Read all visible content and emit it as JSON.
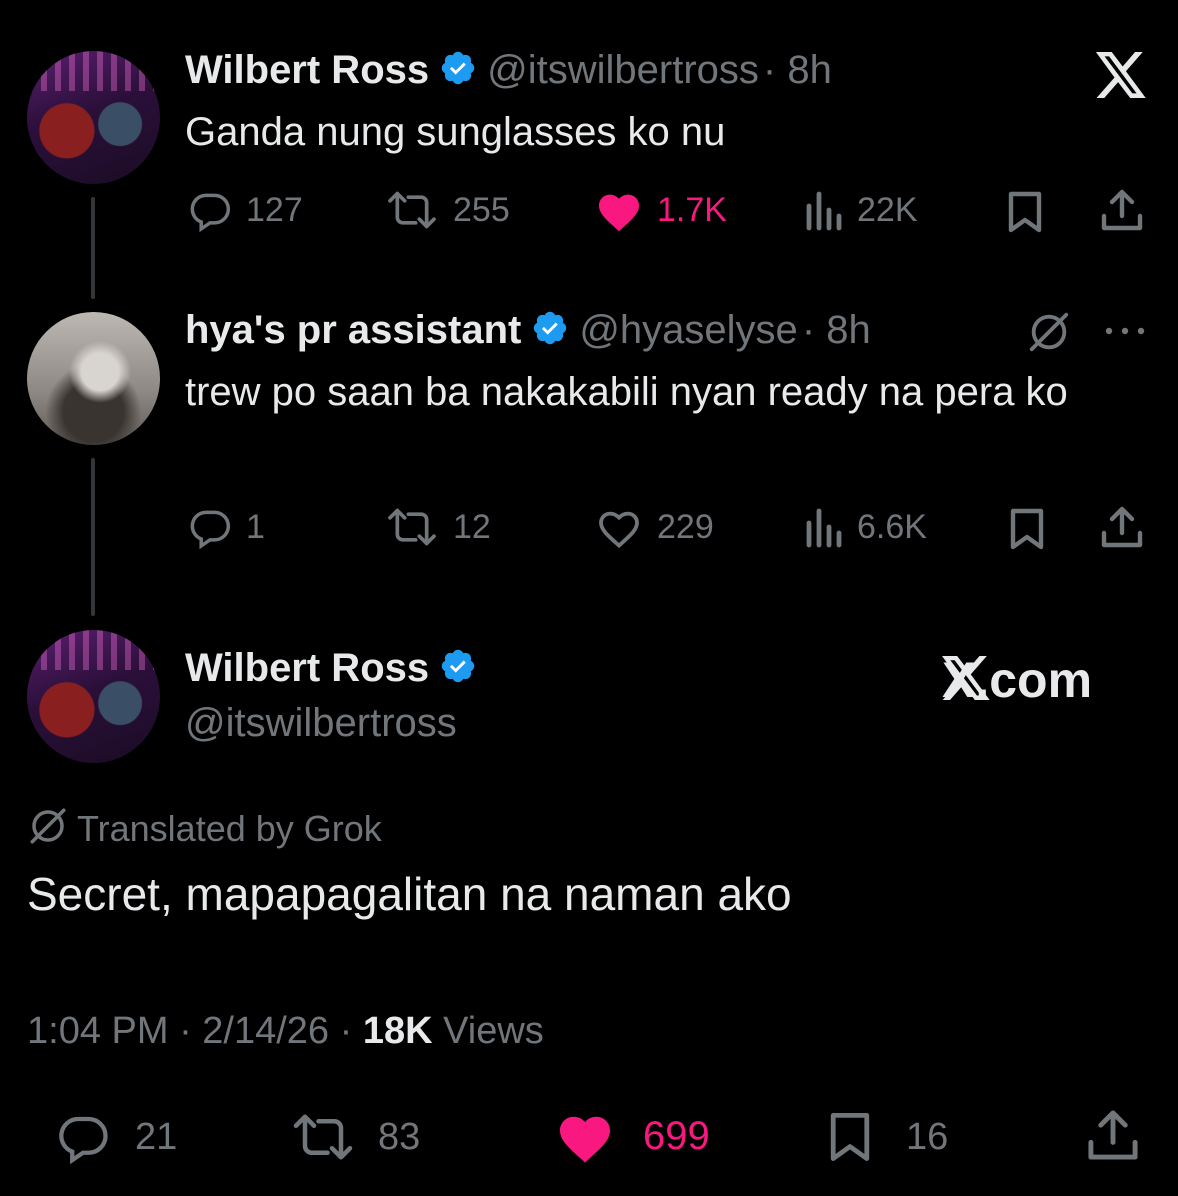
{
  "tweet1": {
    "name": "Wilbert Ross",
    "handle": "@itswilbertross",
    "time": "· 8h",
    "text": "Ganda nung sunglasses ko nu",
    "replies": "127",
    "reposts": "255",
    "likes": "1.7K",
    "views": "22K"
  },
  "tweet2": {
    "name": "hya's pr assistant",
    "handle": "@hyaselyse",
    "time": "· 8h",
    "text": "trew po saan ba nakakabili nyan ready na pera ko",
    "replies": "1",
    "reposts": "12",
    "likes": "229",
    "views": "6.6K"
  },
  "main": {
    "name": "Wilbert Ross",
    "handle": "@itswilbertross",
    "site": "X.com",
    "translated_label": "Translated by Grok",
    "text": "Secret, mapapagalitan na naman ako",
    "time": "1:04 PM · 2/14/26 · ",
    "views_count": "18K",
    "views_label": " Views",
    "replies": "21",
    "reposts": "83",
    "likes": "699",
    "bookmarks": "16"
  },
  "colors": {
    "accent": "#1d9bf0",
    "like": "#f91880",
    "muted": "#71767b"
  },
  "icons": [
    "x-logo-icon",
    "verified-badge-icon",
    "reply-icon",
    "repost-icon",
    "like-icon",
    "views-icon",
    "bookmark-icon",
    "share-icon",
    "grok-icon",
    "more-icon"
  ]
}
